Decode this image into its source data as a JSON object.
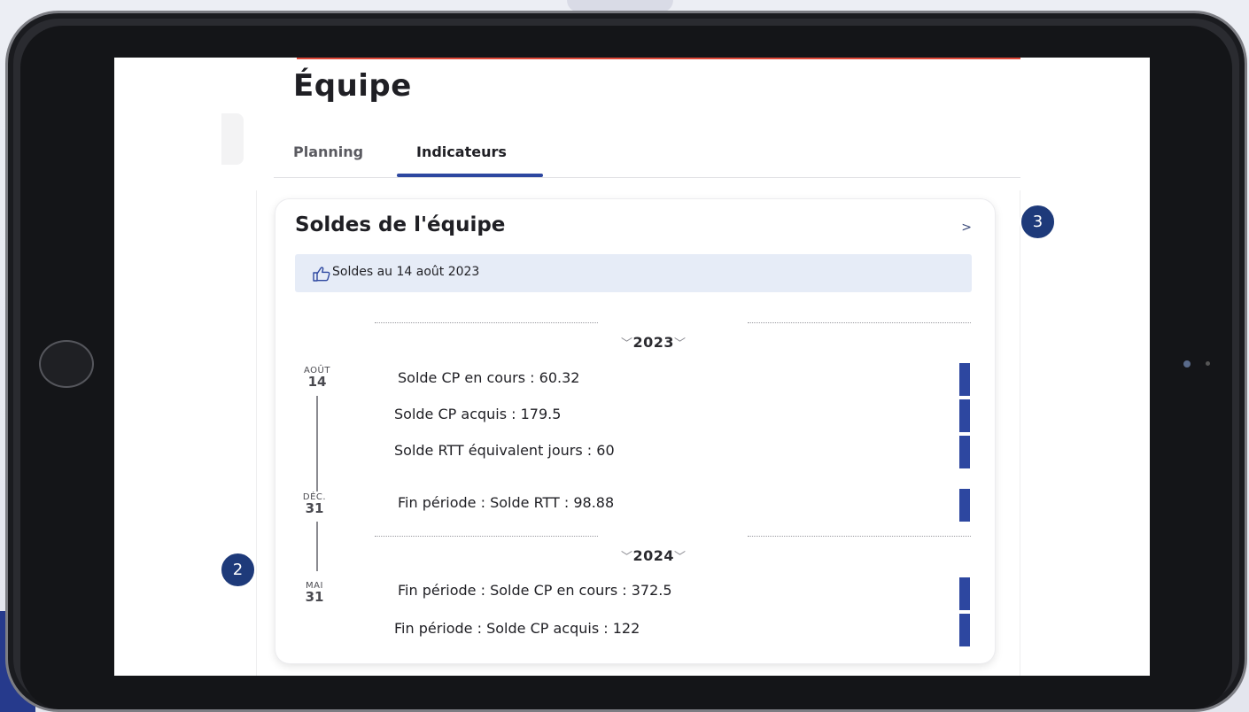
{
  "page": {
    "title": "Équipe",
    "tabs": [
      {
        "label": "Planning",
        "active": false
      },
      {
        "label": "Indicateurs",
        "active": true
      }
    ]
  },
  "card": {
    "title": "Soldes de l'équipe",
    "chevron": ">",
    "info_icon": "thumbs-up-outline-icon",
    "info_text": "Soldes au 14 août 2023",
    "years": [
      {
        "year": "2023",
        "dates": [
          {
            "month": "AOÛT",
            "day": "14",
            "items": [
              "Solde CP en cours : 60.32",
              "Solde CP acquis : 179.5",
              "Solde RTT équivalent jours : 60"
            ]
          },
          {
            "month": "DÉC.",
            "day": "31",
            "items": [
              "Fin période : Solde RTT : 98.88"
            ]
          }
        ]
      },
      {
        "year": "2024",
        "dates": [
          {
            "month": "MAI",
            "day": "31",
            "items": [
              "Fin période : Solde CP en cours : 372.5",
              "Fin période : Solde CP acquis : 122"
            ]
          }
        ]
      }
    ],
    "year_chevron": "﹀"
  },
  "callouts": [
    {
      "number": "3"
    },
    {
      "number": "2"
    }
  ],
  "colors": {
    "accent": "#2d47a0",
    "info_bg": "#e6ecf7",
    "top_rule": "#e04a3a",
    "badge": "#1e3a7a"
  }
}
